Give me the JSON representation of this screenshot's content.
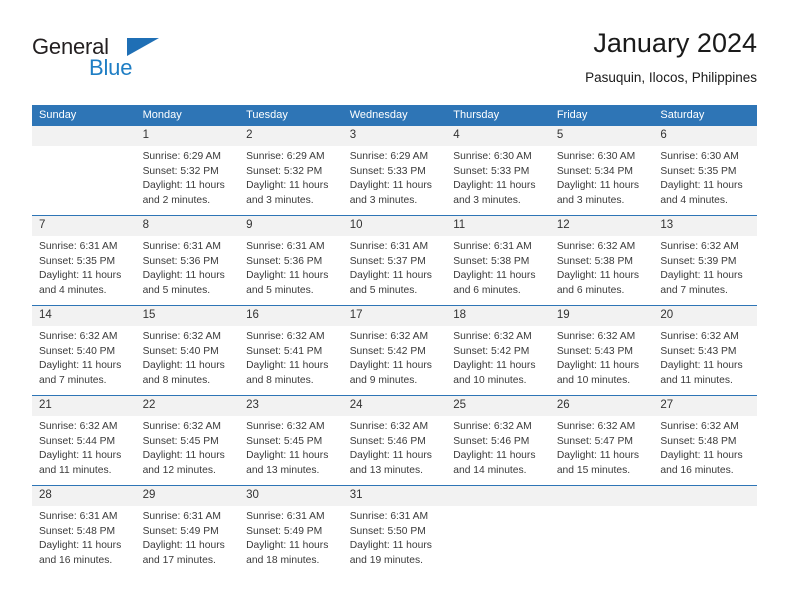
{
  "brand": {
    "name_top": "General",
    "name_bottom": "Blue",
    "triangle_color": "#1f6fb5",
    "blue_color": "#1f7ec4"
  },
  "header": {
    "title": "January 2024",
    "subtitle": "Pasuquin, Ilocos, Philippines"
  },
  "theme": {
    "header_bg": "#2e75b6",
    "daynum_bg": "#f2f2f2",
    "text": "#3a3a3a"
  },
  "weekday_headers": [
    "Sunday",
    "Monday",
    "Tuesday",
    "Wednesday",
    "Thursday",
    "Friday",
    "Saturday"
  ],
  "weeks": [
    [
      {
        "day": "",
        "sunrise": "",
        "sunset": "",
        "daylight1": "",
        "daylight2": ""
      },
      {
        "day": "1",
        "sunrise": "Sunrise: 6:29 AM",
        "sunset": "Sunset: 5:32 PM",
        "daylight1": "Daylight: 11 hours",
        "daylight2": "and 2 minutes."
      },
      {
        "day": "2",
        "sunrise": "Sunrise: 6:29 AM",
        "sunset": "Sunset: 5:32 PM",
        "daylight1": "Daylight: 11 hours",
        "daylight2": "and 3 minutes."
      },
      {
        "day": "3",
        "sunrise": "Sunrise: 6:29 AM",
        "sunset": "Sunset: 5:33 PM",
        "daylight1": "Daylight: 11 hours",
        "daylight2": "and 3 minutes."
      },
      {
        "day": "4",
        "sunrise": "Sunrise: 6:30 AM",
        "sunset": "Sunset: 5:33 PM",
        "daylight1": "Daylight: 11 hours",
        "daylight2": "and 3 minutes."
      },
      {
        "day": "5",
        "sunrise": "Sunrise: 6:30 AM",
        "sunset": "Sunset: 5:34 PM",
        "daylight1": "Daylight: 11 hours",
        "daylight2": "and 3 minutes."
      },
      {
        "day": "6",
        "sunrise": "Sunrise: 6:30 AM",
        "sunset": "Sunset: 5:35 PM",
        "daylight1": "Daylight: 11 hours",
        "daylight2": "and 4 minutes."
      }
    ],
    [
      {
        "day": "7",
        "sunrise": "Sunrise: 6:31 AM",
        "sunset": "Sunset: 5:35 PM",
        "daylight1": "Daylight: 11 hours",
        "daylight2": "and 4 minutes."
      },
      {
        "day": "8",
        "sunrise": "Sunrise: 6:31 AM",
        "sunset": "Sunset: 5:36 PM",
        "daylight1": "Daylight: 11 hours",
        "daylight2": "and 5 minutes."
      },
      {
        "day": "9",
        "sunrise": "Sunrise: 6:31 AM",
        "sunset": "Sunset: 5:36 PM",
        "daylight1": "Daylight: 11 hours",
        "daylight2": "and 5 minutes."
      },
      {
        "day": "10",
        "sunrise": "Sunrise: 6:31 AM",
        "sunset": "Sunset: 5:37 PM",
        "daylight1": "Daylight: 11 hours",
        "daylight2": "and 5 minutes."
      },
      {
        "day": "11",
        "sunrise": "Sunrise: 6:31 AM",
        "sunset": "Sunset: 5:38 PM",
        "daylight1": "Daylight: 11 hours",
        "daylight2": "and 6 minutes."
      },
      {
        "day": "12",
        "sunrise": "Sunrise: 6:32 AM",
        "sunset": "Sunset: 5:38 PM",
        "daylight1": "Daylight: 11 hours",
        "daylight2": "and 6 minutes."
      },
      {
        "day": "13",
        "sunrise": "Sunrise: 6:32 AM",
        "sunset": "Sunset: 5:39 PM",
        "daylight1": "Daylight: 11 hours",
        "daylight2": "and 7 minutes."
      }
    ],
    [
      {
        "day": "14",
        "sunrise": "Sunrise: 6:32 AM",
        "sunset": "Sunset: 5:40 PM",
        "daylight1": "Daylight: 11 hours",
        "daylight2": "and 7 minutes."
      },
      {
        "day": "15",
        "sunrise": "Sunrise: 6:32 AM",
        "sunset": "Sunset: 5:40 PM",
        "daylight1": "Daylight: 11 hours",
        "daylight2": "and 8 minutes."
      },
      {
        "day": "16",
        "sunrise": "Sunrise: 6:32 AM",
        "sunset": "Sunset: 5:41 PM",
        "daylight1": "Daylight: 11 hours",
        "daylight2": "and 8 minutes."
      },
      {
        "day": "17",
        "sunrise": "Sunrise: 6:32 AM",
        "sunset": "Sunset: 5:42 PM",
        "daylight1": "Daylight: 11 hours",
        "daylight2": "and 9 minutes."
      },
      {
        "day": "18",
        "sunrise": "Sunrise: 6:32 AM",
        "sunset": "Sunset: 5:42 PM",
        "daylight1": "Daylight: 11 hours",
        "daylight2": "and 10 minutes."
      },
      {
        "day": "19",
        "sunrise": "Sunrise: 6:32 AM",
        "sunset": "Sunset: 5:43 PM",
        "daylight1": "Daylight: 11 hours",
        "daylight2": "and 10 minutes."
      },
      {
        "day": "20",
        "sunrise": "Sunrise: 6:32 AM",
        "sunset": "Sunset: 5:43 PM",
        "daylight1": "Daylight: 11 hours",
        "daylight2": "and 11 minutes."
      }
    ],
    [
      {
        "day": "21",
        "sunrise": "Sunrise: 6:32 AM",
        "sunset": "Sunset: 5:44 PM",
        "daylight1": "Daylight: 11 hours",
        "daylight2": "and 11 minutes."
      },
      {
        "day": "22",
        "sunrise": "Sunrise: 6:32 AM",
        "sunset": "Sunset: 5:45 PM",
        "daylight1": "Daylight: 11 hours",
        "daylight2": "and 12 minutes."
      },
      {
        "day": "23",
        "sunrise": "Sunrise: 6:32 AM",
        "sunset": "Sunset: 5:45 PM",
        "daylight1": "Daylight: 11 hours",
        "daylight2": "and 13 minutes."
      },
      {
        "day": "24",
        "sunrise": "Sunrise: 6:32 AM",
        "sunset": "Sunset: 5:46 PM",
        "daylight1": "Daylight: 11 hours",
        "daylight2": "and 13 minutes."
      },
      {
        "day": "25",
        "sunrise": "Sunrise: 6:32 AM",
        "sunset": "Sunset: 5:46 PM",
        "daylight1": "Daylight: 11 hours",
        "daylight2": "and 14 minutes."
      },
      {
        "day": "26",
        "sunrise": "Sunrise: 6:32 AM",
        "sunset": "Sunset: 5:47 PM",
        "daylight1": "Daylight: 11 hours",
        "daylight2": "and 15 minutes."
      },
      {
        "day": "27",
        "sunrise": "Sunrise: 6:32 AM",
        "sunset": "Sunset: 5:48 PM",
        "daylight1": "Daylight: 11 hours",
        "daylight2": "and 16 minutes."
      }
    ],
    [
      {
        "day": "28",
        "sunrise": "Sunrise: 6:31 AM",
        "sunset": "Sunset: 5:48 PM",
        "daylight1": "Daylight: 11 hours",
        "daylight2": "and 16 minutes."
      },
      {
        "day": "29",
        "sunrise": "Sunrise: 6:31 AM",
        "sunset": "Sunset: 5:49 PM",
        "daylight1": "Daylight: 11 hours",
        "daylight2": "and 17 minutes."
      },
      {
        "day": "30",
        "sunrise": "Sunrise: 6:31 AM",
        "sunset": "Sunset: 5:49 PM",
        "daylight1": "Daylight: 11 hours",
        "daylight2": "and 18 minutes."
      },
      {
        "day": "31",
        "sunrise": "Sunrise: 6:31 AM",
        "sunset": "Sunset: 5:50 PM",
        "daylight1": "Daylight: 11 hours",
        "daylight2": "and 19 minutes."
      },
      {
        "day": "",
        "sunrise": "",
        "sunset": "",
        "daylight1": "",
        "daylight2": ""
      },
      {
        "day": "",
        "sunrise": "",
        "sunset": "",
        "daylight1": "",
        "daylight2": ""
      },
      {
        "day": "",
        "sunrise": "",
        "sunset": "",
        "daylight1": "",
        "daylight2": ""
      }
    ]
  ]
}
